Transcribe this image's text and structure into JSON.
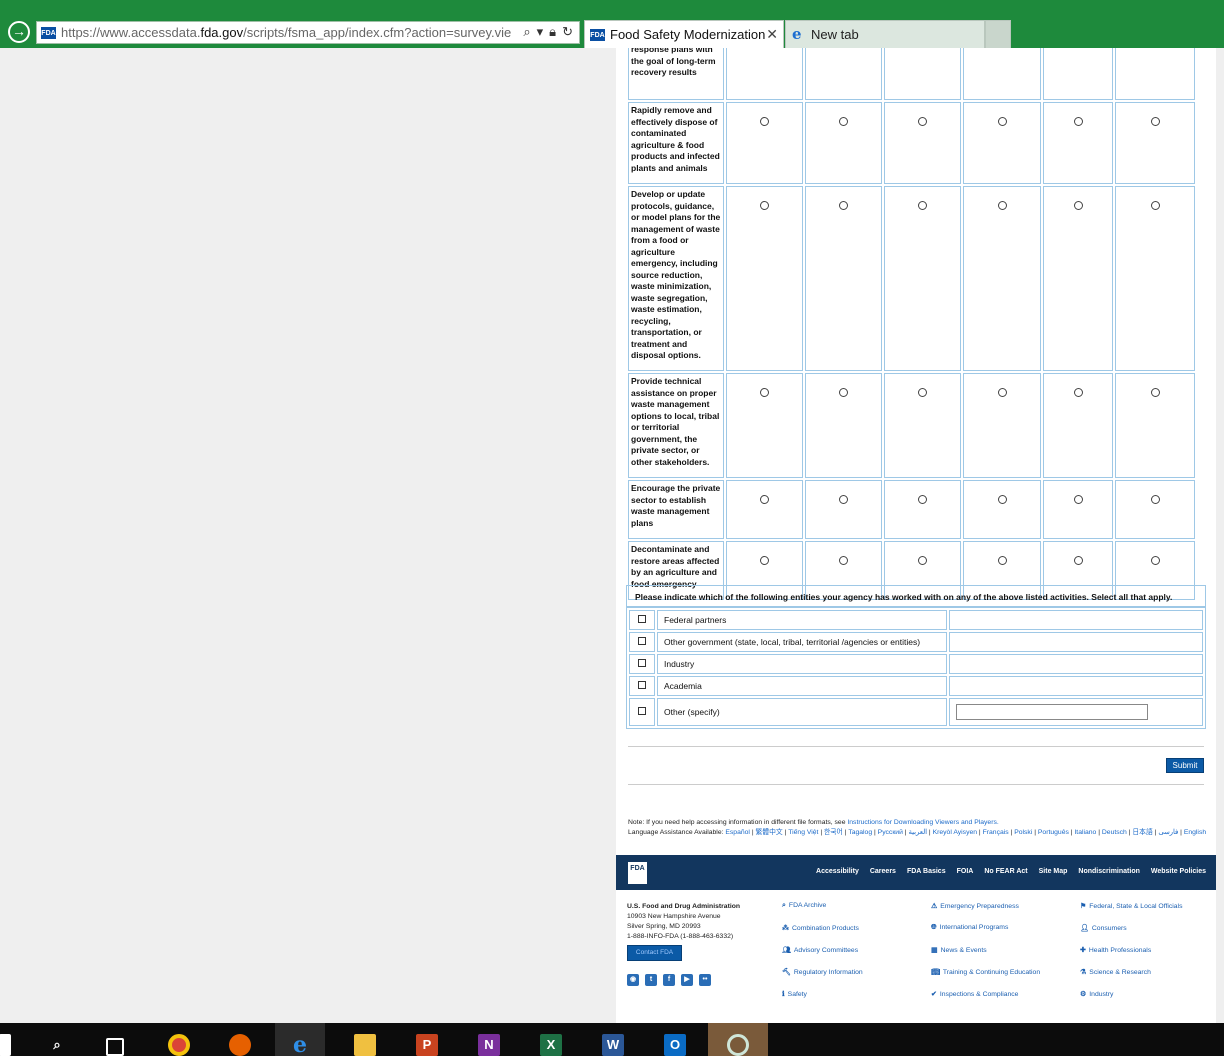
{
  "browser": {
    "url_prefix": "https://www.accessdata.",
    "url_domain": "fda.gov",
    "url_suffix": "/scripts/fsma_app/index.cfm?action=survey.viewSun",
    "favicon_text": "FDA",
    "tabs": [
      {
        "label": "Food Safety Modernization ..."
      },
      {
        "label": "New tab"
      }
    ]
  },
  "survey": {
    "rows": [
      {
        "text": "response plans with the goal of long-term recovery results"
      },
      {
        "text": "Rapidly remove and effectively dispose of contaminated agriculture & food products and infected plants and animals"
      },
      {
        "text": "Develop or update protocols, guidance, or model plans for the management of waste from a food or agriculture emergency, including source reduction, waste minimization, waste segregation, waste estimation, recycling, transportation, or treatment and disposal options."
      },
      {
        "text": "Provide technical assistance on proper waste management options to local, tribal or territorial government, the private sector, or other stakeholders."
      },
      {
        "text": "Encourage the private sector to establish waste management plans"
      },
      {
        "text": "Decontaminate and restore areas affected by an agriculture and food emergency"
      }
    ],
    "entities_prompt": "Please indicate which of the following entities your agency has worked with on any of the above listed activities. Select all that apply.",
    "entities": [
      "Federal partners",
      "Other government (state, local, tribal, territorial /agencies or entities)",
      "Industry",
      "Academia",
      "Other (specify)"
    ],
    "other_value": "",
    "submit_label": "Submit"
  },
  "note": {
    "prefix": "Note: If you need help accessing information in different file formats, see ",
    "link": "Instructions for Downloading Viewers and Players.",
    "lang_prefix": "Language Assistance Available: ",
    "languages": [
      "Español",
      "繁體中文",
      "Tiếng Việt",
      "한국어",
      "Tagalog",
      "Русский",
      "العربية",
      "Kreyòl Ayisyen",
      "Français",
      "Polski",
      "Português",
      "Italiano",
      "Deutsch",
      "日本語",
      "فارسی",
      "English"
    ]
  },
  "footer": {
    "logo_text": "FDA",
    "nav": [
      "Accessibility",
      "Careers",
      "FDA Basics",
      "FOIA",
      "No FEAR Act",
      "Site Map",
      "Nondiscrimination",
      "Website Policies"
    ],
    "agency_name": "U.S. Food and Drug Administration",
    "address1": "10903 New Hampshire Avenue",
    "address2": "Silver Spring, MD 20993",
    "phone": "1-888-INFO-FDA (1-888-463-6332)",
    "contact_label": "Contact FDA",
    "col1": [
      "FDA Archive",
      "Combination Products",
      "Advisory Committees",
      "Regulatory Information",
      "Safety"
    ],
    "col2": [
      "Emergency Preparedness",
      "International Programs",
      "News & Events",
      "Training & Continuing Education",
      "Inspections & Compliance"
    ],
    "col3": [
      "Federal, State & Local Officials",
      "Consumers",
      "Health Professionals",
      "Science & Research",
      "Industry"
    ]
  },
  "taskbar": {
    "apps": [
      "start",
      "search",
      "task-view",
      "chrome",
      "firefox",
      "internet-explorer",
      "file-explorer",
      "powerpoint",
      "onenote",
      "excel",
      "word",
      "outlook",
      "other-app"
    ]
  }
}
